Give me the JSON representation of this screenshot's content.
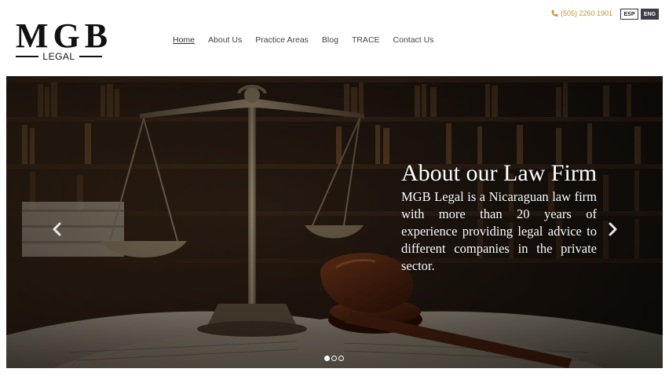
{
  "logo": {
    "main": "MGB",
    "sub": "LEGAL"
  },
  "nav": {
    "items": [
      {
        "label": "Home",
        "active": true
      },
      {
        "label": "About Us",
        "active": false
      },
      {
        "label": "Practice Areas",
        "active": false
      },
      {
        "label": "Blog",
        "active": false
      },
      {
        "label": "TRACE",
        "active": false
      },
      {
        "label": "Contact Us",
        "active": false
      }
    ]
  },
  "contact": {
    "phone": "(505) 2260 1901",
    "phone_icon": "phone-icon"
  },
  "languages": {
    "esp": "ESP",
    "eng": "ENG",
    "active": "ENG"
  },
  "hero": {
    "title": "About our Law Firm",
    "body": "MGB Legal is a Nicaraguan law firm with more than 20 years of experience providing legal advice to different companies in the private sector.",
    "image": "law-library-scales-gavel",
    "prev_icon": "chevron-left-icon",
    "next_icon": "chevron-right-icon",
    "slides_total": 3,
    "slide_active": 1
  },
  "colors": {
    "accent": "#c8932f",
    "lang_active_bg": "#3b3f47",
    "text": "#444444"
  }
}
